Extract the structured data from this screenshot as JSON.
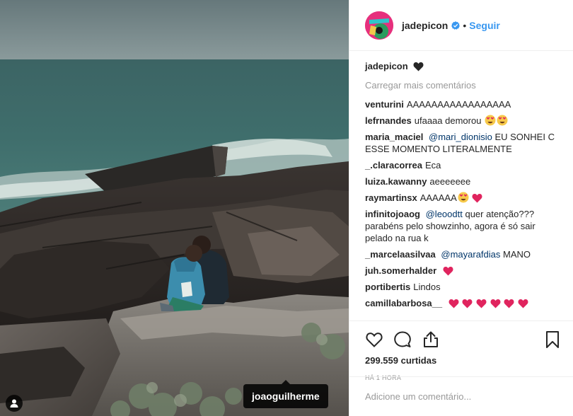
{
  "post": {
    "author": "jadepicon",
    "follow_label": "Seguir",
    "separator": "•",
    "caption_user": "jadepicon",
    "load_more": "Carregar mais comentários",
    "tagged_user": "joaoguilherme",
    "likes": "299.559 curtidas",
    "time": "HÁ 1 HORA",
    "comment_placeholder": "Adicione um comentário..."
  },
  "comments": [
    {
      "user": "venturini",
      "text": "AAAAAAAAAAAAAAAAA"
    },
    {
      "user": "lefrnandes",
      "text": "ufaaaa demorou",
      "emoji": "heart-eyes-emoji x2"
    },
    {
      "user": "maria_maciel",
      "mention": "@mari_dionisio",
      "text": "EU SONHEI C ESSE MOMENTO LITERALMENTE"
    },
    {
      "user": "_.claracorrea",
      "text": "Eca"
    },
    {
      "user": "luiza.kawanny",
      "text": "aeeeeeee"
    },
    {
      "user": "raymartinsx",
      "text": "AAAAAA",
      "emoji": "heart-eyes-emoji, red-heart-emoji"
    },
    {
      "user": "infinitojoaog",
      "mention": "@leoodtt",
      "text": "quer atenção??? parabéns pelo showzinho, agora é só sair pelado na rua k"
    },
    {
      "user": "_marcelaasilvaa",
      "mention": "@mayarafdias",
      "text": "MANO"
    },
    {
      "user": "juh.somerhalder",
      "text": "",
      "emoji": "red-heart-emoji"
    },
    {
      "user": "portibertis",
      "text": "Lindos"
    },
    {
      "user": "camillabarbosa__",
      "text": "",
      "emoji": "red-heart-emoji x6"
    }
  ],
  "icons": {
    "caption_heart": "black-heart-emoji",
    "verified": "verified-badge-icon",
    "like": "heart-outline-icon",
    "comment": "comment-bubble-icon",
    "share": "share-upload-icon",
    "save": "bookmark-icon",
    "user_tags": "person-tag-icon"
  },
  "colors": {
    "link_blue": "#3897f0",
    "mention_blue": "#003569",
    "muted_gray": "#999999",
    "heart_red": "#ed4956",
    "border": "#efefef"
  }
}
